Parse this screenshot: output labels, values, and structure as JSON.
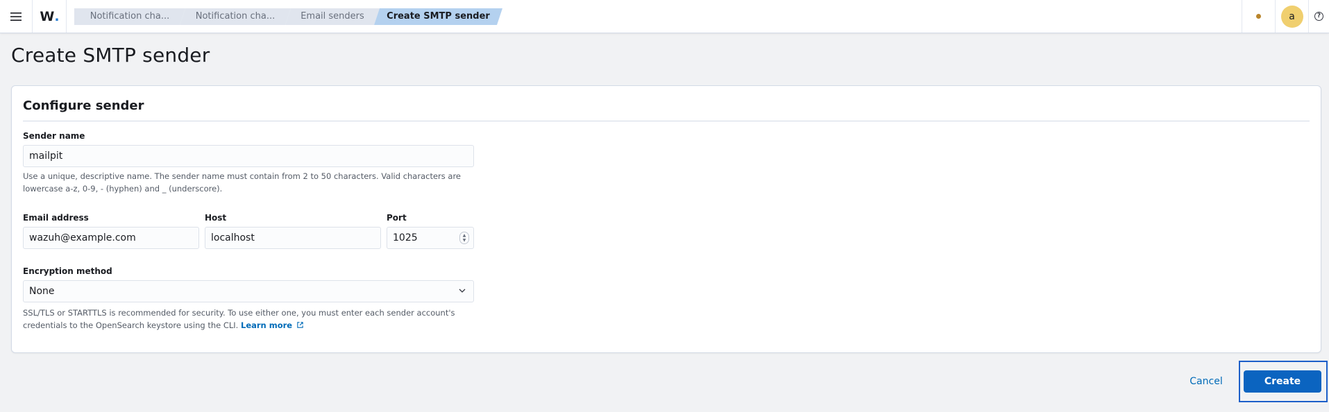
{
  "header": {
    "menu_icon": "hamburger-menu-icon",
    "logo": {
      "text": "W",
      "dot": "."
    },
    "breadcrumbs": [
      {
        "label": "Notification cha..."
      },
      {
        "label": "Notification cha..."
      },
      {
        "label": "Email senders"
      },
      {
        "label": "Create SMTP sender"
      }
    ],
    "status_icon": "status-dot-icon",
    "avatar_initial": "a",
    "help_icon": "help-icon"
  },
  "page": {
    "title": "Create SMTP sender"
  },
  "form": {
    "section_title": "Configure sender",
    "sender_name": {
      "label": "Sender name",
      "value": "mailpit",
      "help_line1": "Use a unique, descriptive name. The sender name must contain from 2 to 50 characters. Valid characters are",
      "help_line2": "lowercase a-z, 0-9, - (hyphen) and _ (underscore)."
    },
    "email": {
      "label": "Email address",
      "value": "wazuh@example.com"
    },
    "host": {
      "label": "Host",
      "value": "localhost"
    },
    "port": {
      "label": "Port",
      "value": "1025"
    },
    "encryption": {
      "label": "Encryption method",
      "selected": "None",
      "help_line1": "SSL/TLS or STARTTLS is recommended for security. To use either one, you must enter each sender account's",
      "help_line2": "credentials to the OpenSearch keystore using the CLI.",
      "link_label": "Learn more",
      "link_icon": "external-link-icon"
    }
  },
  "footer": {
    "cancel_label": "Cancel",
    "create_label": "Create"
  },
  "colors": {
    "accent": "#0b64c0",
    "avatar": "#f0cf6f",
    "breadcrumb_active": "#b4d1ef",
    "status_dot": "#b9852b"
  }
}
